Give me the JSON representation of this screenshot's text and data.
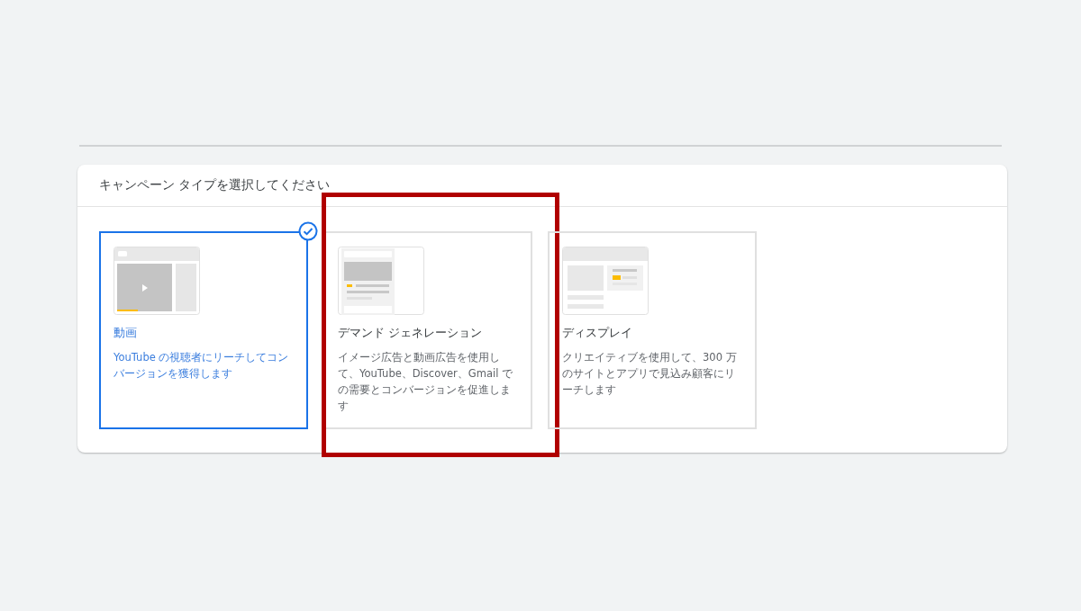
{
  "panel": {
    "title": "キャンペーン タイプを選択してください"
  },
  "campaign_types": [
    {
      "kind": "video",
      "title": "動画",
      "description": "YouTube の視聴者にリーチしてコンバージョンを獲得します",
      "selected": true,
      "highlighted": false
    },
    {
      "kind": "feed",
      "title": "デマンド ジェネレーション",
      "description": "イメージ広告と動画広告を使用して、YouTube、Discover、Gmail での需要とコンバージョンを促進します",
      "selected": false,
      "highlighted": true
    },
    {
      "kind": "display",
      "title": "ディスプレイ",
      "description": "クリエイティブを使用して、300 万のサイトとアプリで見込み顧客にリーチします",
      "selected": false,
      "highlighted": false
    }
  ]
}
